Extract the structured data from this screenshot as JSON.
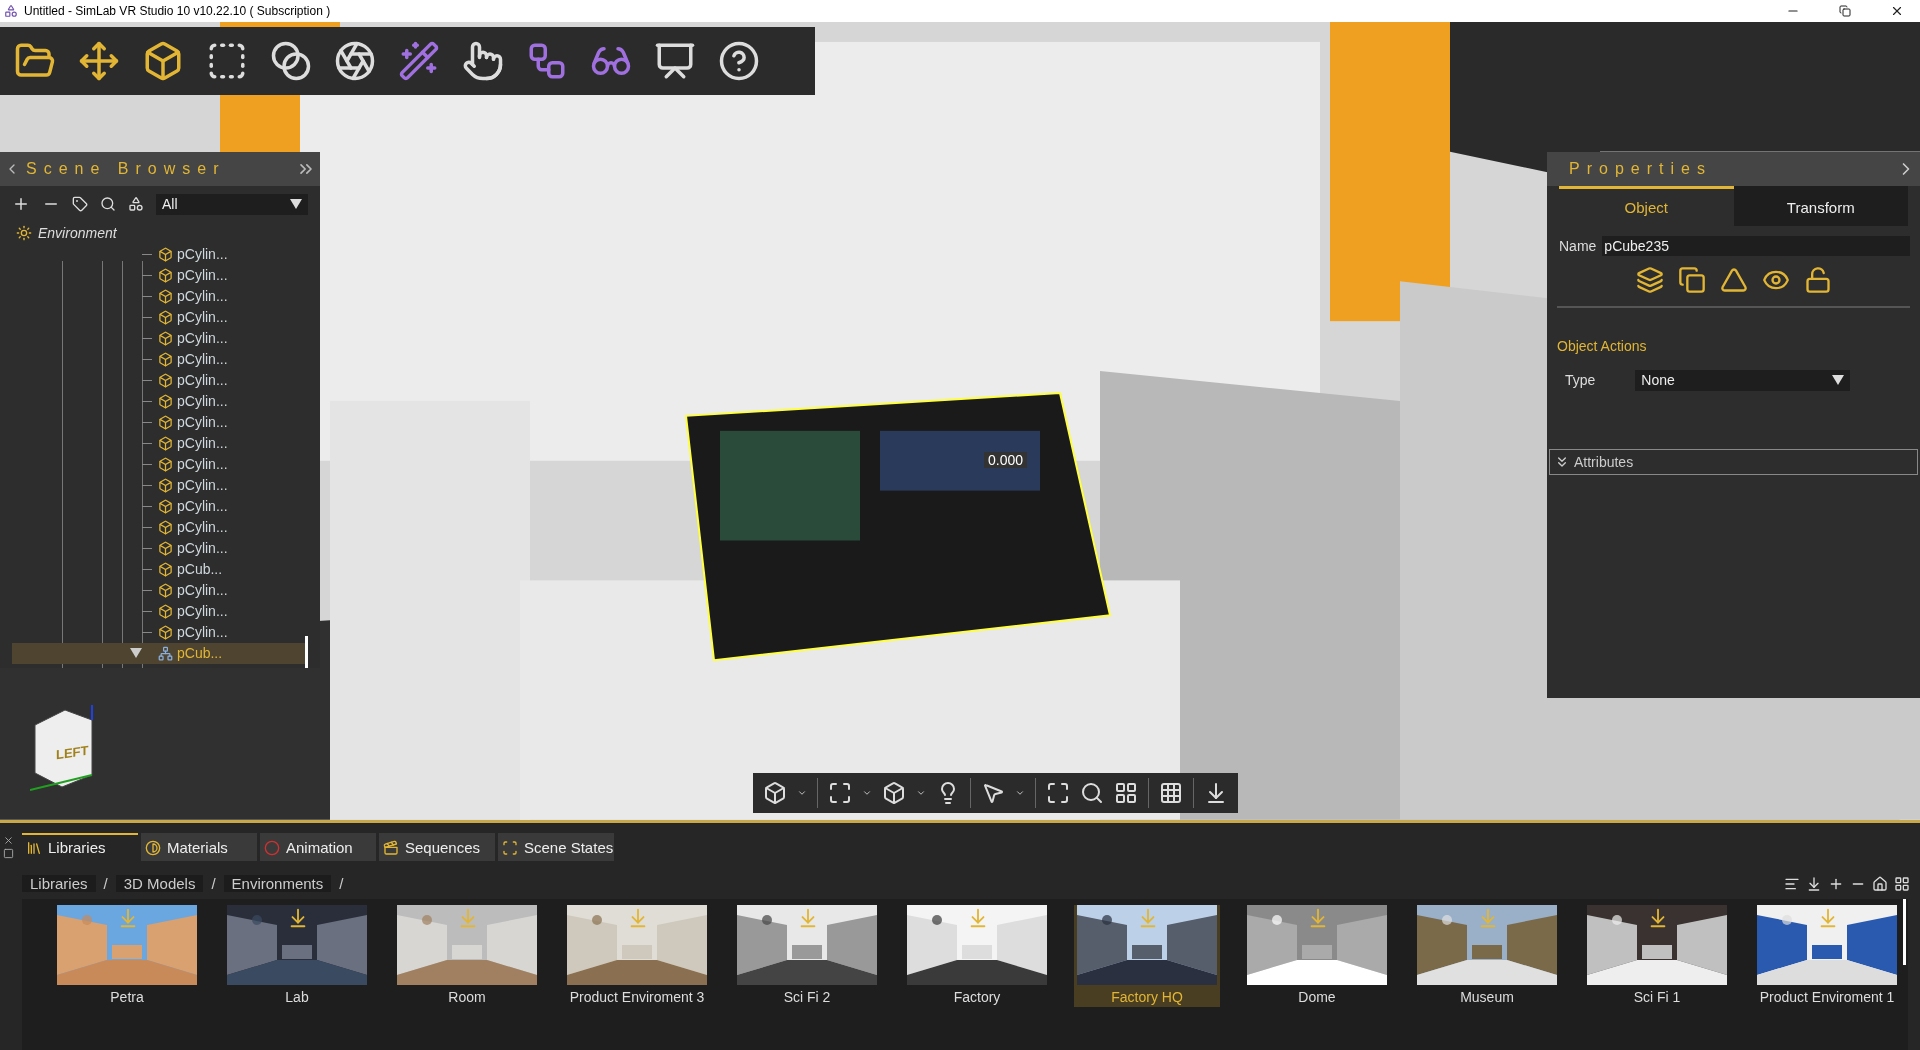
{
  "window": {
    "title": "Untitled - SimLab VR Studio 10 v10.22.10 ( Subscription )"
  },
  "scene_browser": {
    "title": "Scene Browser",
    "filter": "All",
    "tree": [
      {
        "label": "Environment",
        "kind": "environment",
        "children": [
          {
            "label": "pCylin...",
            "kind": "mesh",
            "selected": false
          },
          {
            "label": "pCylin...",
            "kind": "mesh",
            "selected": false
          },
          {
            "label": "pCylin...",
            "kind": "mesh",
            "selected": false
          },
          {
            "label": "pCylin...",
            "kind": "mesh",
            "selected": false
          },
          {
            "label": "pCylin...",
            "kind": "mesh",
            "selected": false
          },
          {
            "label": "pCylin...",
            "kind": "mesh",
            "selected": false
          },
          {
            "label": "pCylin...",
            "kind": "mesh",
            "selected": false
          },
          {
            "label": "pCylin...",
            "kind": "mesh",
            "selected": false
          },
          {
            "label": "pCylin...",
            "kind": "mesh",
            "selected": false
          },
          {
            "label": "pCylin...",
            "kind": "mesh",
            "selected": false
          },
          {
            "label": "pCylin...",
            "kind": "mesh",
            "selected": false
          },
          {
            "label": "pCylin...",
            "kind": "mesh",
            "selected": false
          },
          {
            "label": "pCylin...",
            "kind": "mesh",
            "selected": false
          },
          {
            "label": "pCylin...",
            "kind": "mesh",
            "selected": false
          },
          {
            "label": "pCylin...",
            "kind": "mesh",
            "selected": false
          },
          {
            "label": "pCub...",
            "kind": "mesh",
            "selected": false
          },
          {
            "label": "pCylin...",
            "kind": "mesh",
            "selected": false
          },
          {
            "label": "pCylin...",
            "kind": "mesh",
            "selected": false
          },
          {
            "label": "pCylin...",
            "kind": "mesh",
            "selected": false
          },
          {
            "label": "pCub...",
            "kind": "group",
            "selected": true,
            "expanded": true
          }
        ]
      }
    ]
  },
  "viewport": {
    "gizmo_value": "0.000",
    "view_cube_label": "LEFT"
  },
  "properties": {
    "title": "Properties",
    "tabs": [
      {
        "label": "Object",
        "selected": true
      },
      {
        "label": "Transform",
        "selected": false
      }
    ],
    "name_label": "Name",
    "name_value": "pCube235",
    "section": "Object Actions",
    "type_label": "Type",
    "type_value": "None",
    "attributes": {
      "label": "Attributes",
      "expanded": false
    }
  },
  "bottom_panel": {
    "tabs": [
      {
        "label": "Libraries",
        "selected": true
      },
      {
        "label": "Materials",
        "selected": false
      },
      {
        "label": "Animation",
        "selected": false
      },
      {
        "label": "Sequences",
        "selected": false
      },
      {
        "label": "Scene States",
        "selected": false
      }
    ],
    "breadcrumb": [
      "Libraries",
      "3D Models",
      "Environments"
    ],
    "separator": "/",
    "items": [
      {
        "label": "Petra",
        "selected": false
      },
      {
        "label": "Lab",
        "selected": false
      },
      {
        "label": "Room",
        "selected": false
      },
      {
        "label": "Product Enviroment 3",
        "selected": false
      },
      {
        "label": "Sci Fi 2",
        "selected": false
      },
      {
        "label": "Factory",
        "selected": false
      },
      {
        "label": "Factory HQ",
        "selected": true
      },
      {
        "label": "Dome",
        "selected": false
      },
      {
        "label": "Museum",
        "selected": false
      },
      {
        "label": "Sci Fi 1",
        "selected": false
      },
      {
        "label": "Product Enviroment 1",
        "selected": false
      }
    ]
  }
}
